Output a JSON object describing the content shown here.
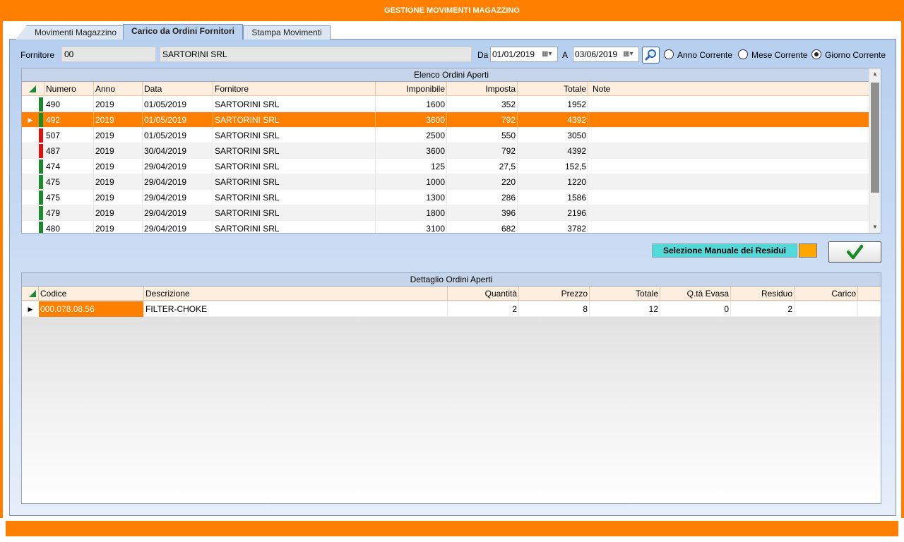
{
  "window": {
    "title": "GESTIONE MOVIMENTI MAGAZZINO"
  },
  "tabs": [
    {
      "label": "Movimenti Magazzino",
      "active": false
    },
    {
      "label": "Carico da Ordini Fornitori",
      "active": true
    },
    {
      "label": "Stampa Movimenti",
      "active": false
    }
  ],
  "filter": {
    "fornitore_label": "Fornitore",
    "fornitore_code": "00",
    "fornitore_name": "SARTORINI SRL",
    "da_label": "Da",
    "da_value": "01/01/2019",
    "a_label": "A",
    "a_value": "03/06/2019",
    "radios": [
      {
        "label": "Anno Corrente",
        "checked": false
      },
      {
        "label": "Mese Corrente",
        "checked": false
      },
      {
        "label": "Giorno Corrente",
        "checked": true
      }
    ]
  },
  "ordini": {
    "caption": "Elenco Ordini Aperti",
    "columns": [
      "Numero",
      "Anno",
      "Data",
      "Fornitore",
      "Imponibile",
      "Imposta",
      "Totale",
      "Note"
    ],
    "rows": [
      {
        "status": "green",
        "numero": "490",
        "anno": "2019",
        "data": "01/05/2019",
        "fornitore": "SARTORINI SRL",
        "imponibile": "1600",
        "imposta": "352",
        "totale": "1952",
        "note": ""
      },
      {
        "status": "green",
        "numero": "492",
        "anno": "2019",
        "data": "01/05/2019",
        "fornitore": "SARTORINI SRL",
        "imponibile": "3600",
        "imposta": "792",
        "totale": "4392",
        "note": ""
      },
      {
        "status": "red",
        "numero": "507",
        "anno": "2019",
        "data": "01/05/2019",
        "fornitore": "SARTORINI SRL",
        "imponibile": "2500",
        "imposta": "550",
        "totale": "3050",
        "note": ""
      },
      {
        "status": "red",
        "numero": "487",
        "anno": "2019",
        "data": "30/04/2019",
        "fornitore": "SARTORINI SRL",
        "imponibile": "3600",
        "imposta": "792",
        "totale": "4392",
        "note": ""
      },
      {
        "status": "green",
        "numero": "474",
        "anno": "2019",
        "data": "29/04/2019",
        "fornitore": "SARTORINI SRL",
        "imponibile": "125",
        "imposta": "27,5",
        "totale": "152,5",
        "note": ""
      },
      {
        "status": "green",
        "numero": "475",
        "anno": "2019",
        "data": "29/04/2019",
        "fornitore": "SARTORINI SRL",
        "imponibile": "1000",
        "imposta": "220",
        "totale": "1220",
        "note": ""
      },
      {
        "status": "green",
        "numero": "475",
        "anno": "2019",
        "data": "29/04/2019",
        "fornitore": "SARTORINI SRL",
        "imponibile": "1300",
        "imposta": "286",
        "totale": "1586",
        "note": ""
      },
      {
        "status": "green",
        "numero": "479",
        "anno": "2019",
        "data": "29/04/2019",
        "fornitore": "SARTORINI SRL",
        "imponibile": "1800",
        "imposta": "396",
        "totale": "2196",
        "note": ""
      },
      {
        "status": "green",
        "numero": "480",
        "anno": "2019",
        "data": "29/04/2019",
        "fornitore": "SARTORINI SRL",
        "imponibile": "3100",
        "imposta": "682",
        "totale": "3782",
        "note": ""
      }
    ],
    "selected_index": 1
  },
  "residui": {
    "label": "Selezione Manuale dei Residui",
    "swatch_color": "#ffa500"
  },
  "dettaglio": {
    "caption": "Dettaglio Ordini Aperti",
    "columns": [
      "Codice",
      "Descrizione",
      "Quantità",
      "Prezzo",
      "Totale",
      "Q.tà Evasa",
      "Residuo",
      "Carico"
    ],
    "rows": [
      {
        "codice": "000.078.08.56",
        "descrizione": "FILTER-CHOKE",
        "quantita": "2",
        "prezzo": "8",
        "totale": "12",
        "evasa": "0",
        "residuo": "2",
        "carico": ""
      }
    ]
  },
  "colors": {
    "accent": "#ff8000",
    "status_green": "#1a8a2a",
    "status_red": "#e01010",
    "checkmark": "#1a8a2a"
  },
  "icons": {
    "search": "magnifier-icon",
    "calendar": "calendar-icon",
    "confirm": "checkmark-icon"
  }
}
